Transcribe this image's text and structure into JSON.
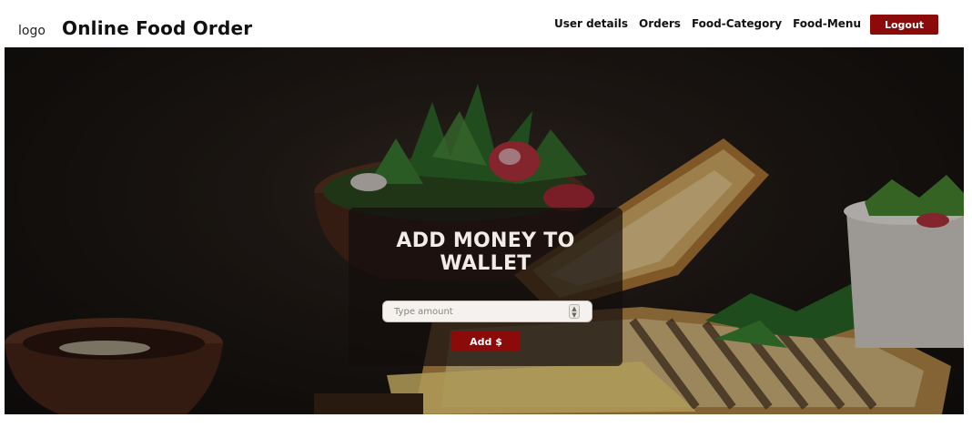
{
  "navbar": {
    "logo_text": "logo",
    "brand_title": "Online Food Order",
    "links": [
      "User details",
      "Orders",
      "Food-Category",
      "Food-Menu"
    ],
    "logout_label": "Logout"
  },
  "wallet": {
    "title_line1": "ADD MONEY TO",
    "title_line2": "WALLET",
    "amount_placeholder": "Type amount",
    "add_button_label": "Add $"
  },
  "colors": {
    "accent": "#8b0a0a",
    "navbar_bg": "#ffffff",
    "card_bg": "rgba(20,14,12,0.72)"
  },
  "icons": {
    "spinner": "number-stepper-icon"
  }
}
